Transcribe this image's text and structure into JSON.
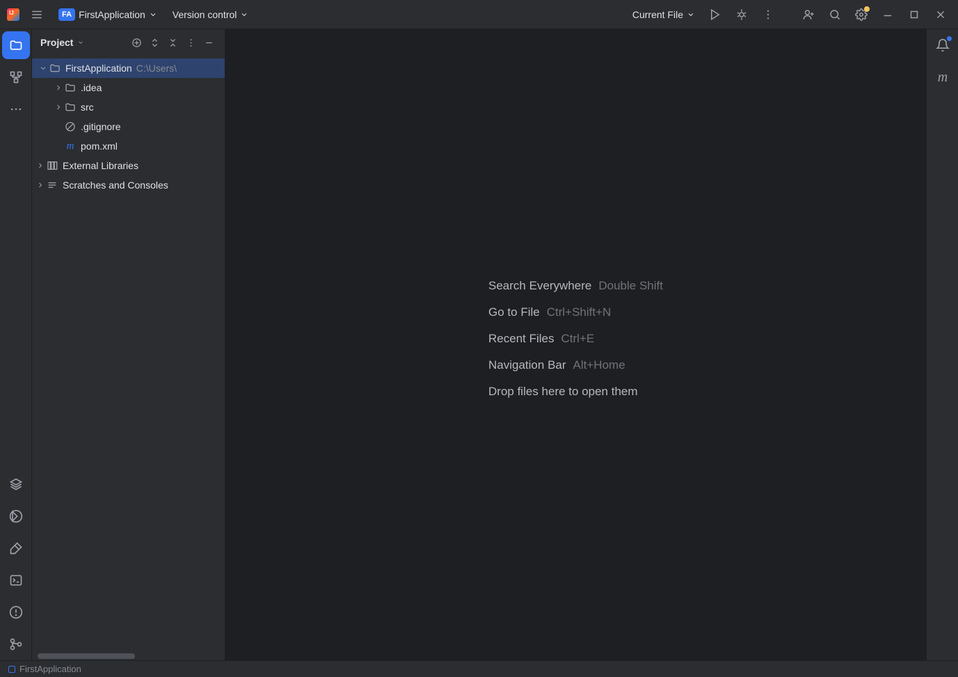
{
  "topbar": {
    "project_badge": "FA",
    "project_name": "FirstApplication",
    "vcs_label": "Version control",
    "run_config": "Current File"
  },
  "project_panel": {
    "title": "Project",
    "tree": [
      {
        "label": "FirstApplication",
        "path": "C:\\Users\\",
        "icon": "project",
        "depth": 0,
        "arrow": "down",
        "selected": true
      },
      {
        "label": ".idea",
        "icon": "folder",
        "depth": 1,
        "arrow": "right"
      },
      {
        "label": "src",
        "icon": "folder",
        "depth": 1,
        "arrow": "right"
      },
      {
        "label": ".gitignore",
        "icon": "gitignore",
        "depth": 1,
        "arrow": ""
      },
      {
        "label": "pom.xml",
        "icon": "maven",
        "depth": 1,
        "arrow": ""
      },
      {
        "label": "External Libraries",
        "icon": "library",
        "depth": 0,
        "arrow": "right",
        "root2": true
      },
      {
        "label": "Scratches and Consoles",
        "icon": "scratch",
        "depth": 0,
        "arrow": "right",
        "root2": true
      }
    ]
  },
  "editor_hints": [
    {
      "action": "Search Everywhere",
      "shortcut": "Double Shift"
    },
    {
      "action": "Go to File",
      "shortcut": "Ctrl+Shift+N"
    },
    {
      "action": "Recent Files",
      "shortcut": "Ctrl+E"
    },
    {
      "action": "Navigation Bar",
      "shortcut": "Alt+Home"
    },
    {
      "action": "Drop files here to open them",
      "shortcut": ""
    }
  ],
  "status": {
    "module": "FirstApplication"
  }
}
